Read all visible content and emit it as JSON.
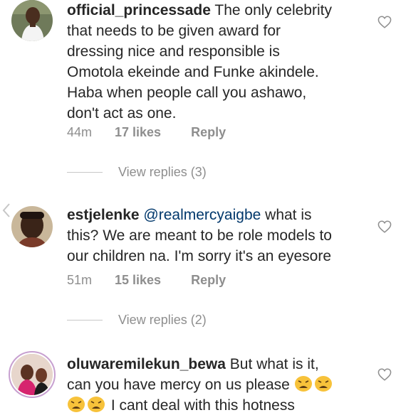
{
  "comments": [
    {
      "username": "official_princessade",
      "text": "The only celebrity that needs to be given award for dressing nice and responsible is Omotola ekeinde and Funke akindele. Haba when people call you ashawo, don't act as one.",
      "time": "44m",
      "likes": "17 likes",
      "reply": "Reply",
      "view_replies": "View replies (3)",
      "lines": [
        "The only celebrity",
        "that needs to be given award for",
        "dressing nice and responsible is",
        "Omotola ekeinde and Funke akindele.",
        "Haba when people call you ashawo,",
        "don't act as one."
      ]
    },
    {
      "username": "estjelenke",
      "mention": "@realmercyaigbe",
      "text": "what is this? We are meant to be role models to our children na. I'm sorry it's an eyesore",
      "time": "51m",
      "likes": "15 likes",
      "reply": "Reply",
      "view_replies": "View replies (2)",
      "lines": [
        "what is",
        "this? We are meant to be role models to",
        "our children na. I'm sorry it's an eyesore"
      ]
    },
    {
      "username": "oluwaremilekun_bewa",
      "text": "But what is it, can you have mercy on us please 😫😫 😫😫 I cant deal with this hotness",
      "lines": [
        "But what is it,",
        "can you have mercy on us please",
        "I cant deal with this hotness"
      ]
    }
  ],
  "icons": {
    "heart": "heart-outline-icon",
    "emoji": "tired-face-emoji",
    "chevron": "chevron-left-icon"
  },
  "colors": {
    "text": "#262626",
    "meta": "#8e8e8e",
    "mention": "#00376b"
  }
}
